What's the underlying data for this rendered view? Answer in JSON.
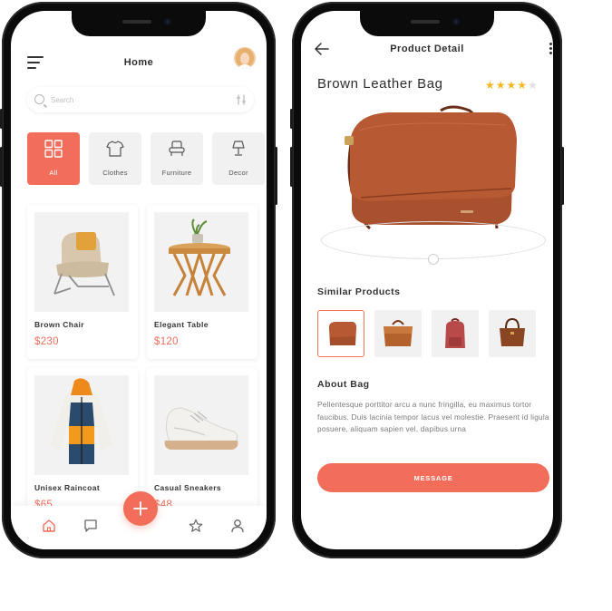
{
  "colors": {
    "accent": "#f26e5b",
    "star": "#f6b820",
    "text": "#2b2b2b",
    "muted": "#7a7a7a"
  },
  "home": {
    "title": "Home",
    "search": {
      "placeholder": "Search"
    },
    "categories": [
      {
        "label": "All",
        "icon": "grid-icon",
        "active": true
      },
      {
        "label": "Clothes",
        "icon": "shirt-icon",
        "active": false
      },
      {
        "label": "Furniture",
        "icon": "armchair-icon",
        "active": false
      },
      {
        "label": "Decor",
        "icon": "lamp-icon",
        "active": false
      }
    ],
    "products": [
      {
        "name": "Brown Chair",
        "price": "$230",
        "image": "chair-image"
      },
      {
        "name": "Elegant Table",
        "price": "$120",
        "image": "table-image"
      },
      {
        "name": "Unisex Raincoat",
        "price": "$65",
        "image": "raincoat-image"
      },
      {
        "name": "Casual Sneakers",
        "price": "$48",
        "image": "sneaker-image"
      }
    ],
    "bottom_nav": [
      "home-icon",
      "chat-icon",
      "add-icon",
      "star-icon",
      "user-icon"
    ]
  },
  "detail": {
    "title": "Product Detail",
    "product_name": "Brown Leather Bag",
    "rating": 4,
    "rating_max": 5,
    "similar_title": "Similar Products",
    "similar": [
      "brown-crossbody-bag",
      "tan-leather-bag",
      "red-backpack",
      "brown-handbag"
    ],
    "about_title": "About Bag",
    "about_text": "Pellentesque porttitor arcu a nunc fringilla, eu maximus tortor faucibus. Duis lacinia tempor lacus vel molestie. Praesent id ligula posuere, aliquam sapien vel, dapibus urna",
    "button_label": "MESSAGE"
  }
}
